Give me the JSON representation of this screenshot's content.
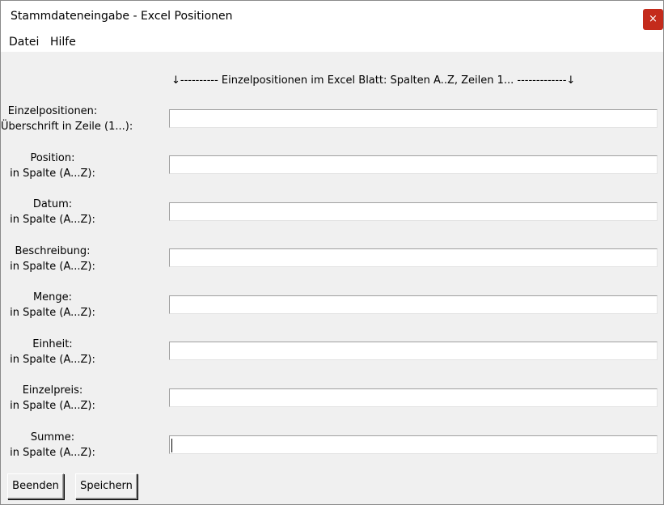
{
  "window": {
    "title": "Stammdateneingabe - Excel Positionen",
    "close_glyph": "×"
  },
  "menu": {
    "items": [
      "Datei",
      "Hilfe"
    ]
  },
  "header_text": "↓---------- Einzelpositionen im Excel Blatt: Spalten A..Z, Zeilen 1...  -------------↓",
  "fields": [
    {
      "line1": "Einzelpositionen:",
      "line2": "Überschrift in Zeile (1...):",
      "value": ""
    },
    {
      "line1": "Position:",
      "line2": "in Spalte (A...Z):",
      "value": ""
    },
    {
      "line1": "Datum:",
      "line2": "in Spalte (A...Z):",
      "value": ""
    },
    {
      "line1": "Beschreibung:",
      "line2": "in Spalte (A...Z):",
      "value": ""
    },
    {
      "line1": "Menge:",
      "line2": "in Spalte (A...Z):",
      "value": ""
    },
    {
      "line1": "Einheit:",
      "line2": "in Spalte (A...Z):",
      "value": ""
    },
    {
      "line1": "Einzelpreis:",
      "line2": "in Spalte (A...Z):",
      "value": ""
    },
    {
      "line1": "Summe:",
      "line2": "in Spalte (A...Z):",
      "value": ""
    }
  ],
  "buttons": {
    "quit": "Beenden",
    "save": "Speichern"
  },
  "colors": {
    "close_button": "#c42b1c",
    "window_background": "#f0f0f0"
  }
}
